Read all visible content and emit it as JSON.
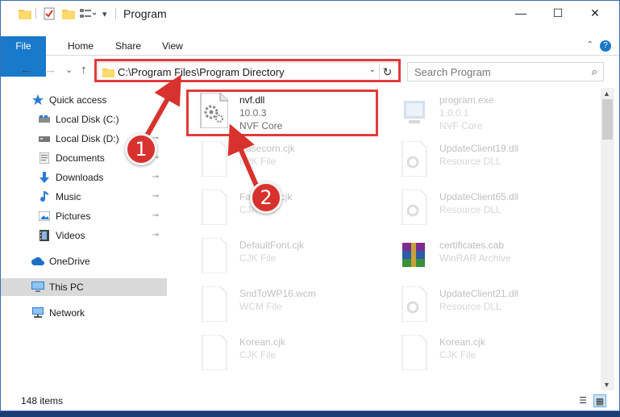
{
  "window": {
    "title": "Program",
    "minimize_glyph": "—",
    "maximize_glyph": "☐",
    "close_glyph": "✕"
  },
  "ribbon": {
    "tabs": [
      "File",
      "Home",
      "Share",
      "View"
    ],
    "help_glyph": "?",
    "collapse_glyph": "⌃"
  },
  "navbar": {
    "back_glyph": "←",
    "forward_glyph": "→",
    "recent_glyph": "⌄",
    "up_glyph": "↑",
    "address_path": "C:\\Program Files\\Program Directory",
    "dropdown_glyph": "⌄",
    "refresh_glyph": "↻",
    "search_placeholder": "Search Program",
    "search_glyph": "⌕"
  },
  "sidebar": {
    "items": [
      {
        "label": "Quick access",
        "icon": "star-icon"
      },
      {
        "label": "Local Disk (C:)",
        "icon": "drive-icon",
        "pinned": true
      },
      {
        "label": "Local Disk (D:)",
        "icon": "drive-icon",
        "pinned": true
      },
      {
        "label": "Documents",
        "icon": "documents-icon",
        "pinned": true
      },
      {
        "label": "Downloads",
        "icon": "downloads-icon",
        "pinned": true
      },
      {
        "label": "Music",
        "icon": "music-icon",
        "pinned": true
      },
      {
        "label": "Pictures",
        "icon": "pictures-icon",
        "pinned": true
      },
      {
        "label": "Videos",
        "icon": "videos-icon",
        "pinned": true
      },
      {
        "label": "OneDrive",
        "icon": "cloud-icon"
      },
      {
        "label": "This PC",
        "icon": "computer-icon",
        "selected": true
      },
      {
        "label": "Network",
        "icon": "network-icon"
      }
    ],
    "pin_glyph": "📌"
  },
  "files": [
    {
      "name": "nvf.dll",
      "line1": "10.0.3",
      "line2": "NVF Core"
    },
    {
      "name": "program.exe",
      "line1": "1.0.0.1",
      "line2": "NVF Core"
    },
    {
      "name": "Basecorn.cjk",
      "line1": "CJK File",
      "line2": ""
    },
    {
      "name": "UpdateClient19.dll",
      "line1": "Resource DLL",
      "line2": ""
    },
    {
      "name": "FastFont.cjk",
      "line1": "CJK File",
      "line2": ""
    },
    {
      "name": "UpdateClient65.dll",
      "line1": "Resource DLL",
      "line2": ""
    },
    {
      "name": "DefaultFont.cjk",
      "line1": "CJK File",
      "line2": ""
    },
    {
      "name": "certificates.cab",
      "line1": "WinRAR Archive",
      "line2": ""
    },
    {
      "name": "SndToWP16.wcm",
      "line1": "WCM File",
      "line2": ""
    },
    {
      "name": "UpdateClient21.dll",
      "line1": "Resource DLL",
      "line2": ""
    },
    {
      "name": "Korean.cjk",
      "line1": "CJK File",
      "line2": ""
    },
    {
      "name": "Korean.cjk",
      "line1": "CJK File",
      "line2": ""
    }
  ],
  "status": {
    "item_count": "148 items"
  },
  "callouts": [
    "1",
    "2"
  ],
  "colors": {
    "accent": "#1979ca",
    "highlight_red": "#e03a3a",
    "badge_red": "#d8322e"
  }
}
